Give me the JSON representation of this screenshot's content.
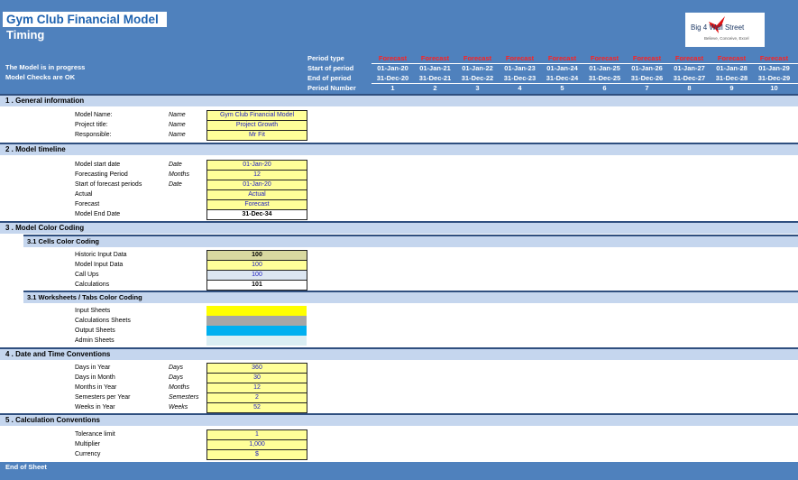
{
  "header": {
    "title": "Gym Club Financial Model",
    "subtitle": "Timing",
    "status_progress": "The Model is in progress",
    "status_checks": "Model Checks are OK"
  },
  "logo": {
    "text": "Big 4 Wall Street",
    "tagline": "Believe, Conceive, Excel"
  },
  "period_header": {
    "labels": [
      "Period type",
      "Start of period",
      "End of period",
      "Period Number"
    ],
    "columns": [
      {
        "type": "Forecast",
        "start": "01-Jan-20",
        "end": "31-Dec-20",
        "number": "1"
      },
      {
        "type": "Forecast",
        "start": "01-Jan-21",
        "end": "31-Dec-21",
        "number": "2"
      },
      {
        "type": "Forecast",
        "start": "01-Jan-22",
        "end": "31-Dec-22",
        "number": "3"
      },
      {
        "type": "Forecast",
        "start": "01-Jan-23",
        "end": "31-Dec-23",
        "number": "4"
      },
      {
        "type": "Forecast",
        "start": "01-Jan-24",
        "end": "31-Dec-24",
        "number": "5"
      },
      {
        "type": "Forecast",
        "start": "01-Jan-25",
        "end": "31-Dec-25",
        "number": "6"
      },
      {
        "type": "Forecast",
        "start": "01-Jan-26",
        "end": "31-Dec-26",
        "number": "7"
      },
      {
        "type": "Forecast",
        "start": "01-Jan-27",
        "end": "31-Dec-27",
        "number": "8"
      },
      {
        "type": "Forecast",
        "start": "01-Jan-28",
        "end": "31-Dec-28",
        "number": "9"
      },
      {
        "type": "Forecast",
        "start": "01-Jan-29",
        "end": "31-Dec-29",
        "number": "10"
      }
    ]
  },
  "sections": {
    "general": {
      "title": "1 .  General information",
      "rows": [
        {
          "label": "Model Name:",
          "unit": "Name",
          "value": "Gym Club Financial Model"
        },
        {
          "label": "Project title:",
          "unit": "Name",
          "value": "Project Growth"
        },
        {
          "label": "Responsible:",
          "unit": "Name",
          "value": "Mr Fit"
        }
      ]
    },
    "timeline": {
      "title": "2 .  Model timeline",
      "rows": [
        {
          "label": "Model start date",
          "unit": "Date",
          "value": "01-Jan-20"
        },
        {
          "label": "Forecasting Period",
          "unit": "Months",
          "value": "12"
        },
        {
          "label": "Start of forecast periods",
          "unit": "Date",
          "value": "01-Jan-20"
        },
        {
          "label": "Actual",
          "unit": "",
          "value": "Actual"
        },
        {
          "label": "Forecast",
          "unit": "",
          "value": "Forecast"
        },
        {
          "label": "Model End Date",
          "unit": "",
          "value": "31-Dec-34"
        }
      ]
    },
    "color_coding": {
      "title": "3 .  Model Color Coding",
      "cells_title": "3.1 Cells Color Coding",
      "cells": [
        {
          "label": "Historic Input Data",
          "value": "100",
          "color": "#d9d9a0"
        },
        {
          "label": "Model Input Data",
          "value": "100",
          "color": "#ffff99"
        },
        {
          "label": "Call Ups",
          "value": "100",
          "color": "#dce6f1"
        },
        {
          "label": "Calculations",
          "value": "101",
          "color": "#ffffff"
        }
      ],
      "tabs_title": "3.1 Worksheets / Tabs Color Coding",
      "tabs": [
        {
          "label": "Input Sheets",
          "color": "#ffff00"
        },
        {
          "label": "Calculations Sheets",
          "color": "#a6a6a6"
        },
        {
          "label": "Output Sheets",
          "color": "#00b0f0"
        },
        {
          "label": "Admin Sheets",
          "color": "#daeef3"
        }
      ]
    },
    "date_time": {
      "title": "4 .  Date and Time Conventions",
      "rows": [
        {
          "label": "Days in Year",
          "unit": "Days",
          "value": "360"
        },
        {
          "label": "Days in Month",
          "unit": "Days",
          "value": "30"
        },
        {
          "label": "Months in Year",
          "unit": "Months",
          "value": "12"
        },
        {
          "label": "Semesters per Year",
          "unit": "Semesters",
          "value": "2"
        },
        {
          "label": "Weeks in Year",
          "unit": "Weeks",
          "value": "52"
        }
      ]
    },
    "calc": {
      "title": "5 .  Calculation Conventions",
      "rows": [
        {
          "label": "Tolerance limit",
          "unit": "",
          "value": "1"
        },
        {
          "label": "Multiplier",
          "unit": "",
          "value": "1,000"
        },
        {
          "label": "Currency",
          "unit": "",
          "value": "$"
        }
      ]
    }
  },
  "footer": {
    "text": "End of Sheet"
  },
  "colors": {
    "header_blue": "#4f81bd",
    "section_bg": "#c5d6ee",
    "forecast_red": "#ff2020",
    "input_yellow": "#ffff99"
  }
}
